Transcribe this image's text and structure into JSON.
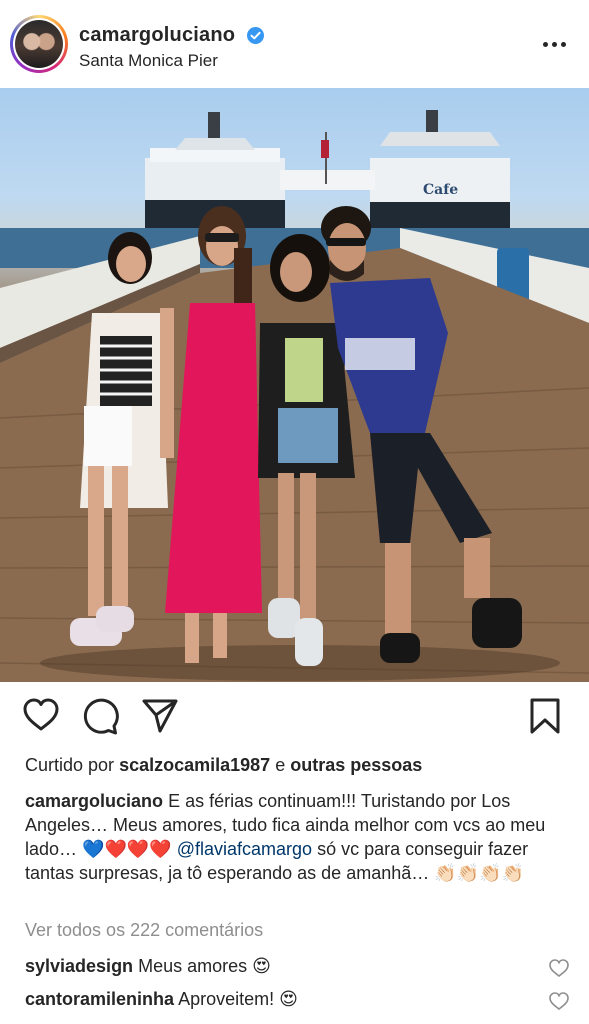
{
  "post": {
    "username": "camargoluciano",
    "location": "Santa Monica Pier",
    "verified": true
  },
  "photo": {
    "signage": "Cafe",
    "description_icon": "family-photo-on-pier"
  },
  "actions": {
    "icons": [
      "heart-icon",
      "comment-icon",
      "share-icon",
      "bookmark-icon"
    ]
  },
  "likes": {
    "prefix": "Curtido por",
    "user": "scalzocamila1987",
    "joiner": "e",
    "others": "outras pessoas"
  },
  "caption": {
    "username": "camargoluciano",
    "text_1": "E as férias continuam!!! Turistando por Los Angeles… Meus amores, tudo fica ainda melhor com vcs ao meu lado…",
    "emojis_1": "💙❤️❤️❤️",
    "mention": "@flaviafcamargo",
    "text_2": "só vc para conseguir fazer tantas surpresas, ja tô esperando as de amanhã…",
    "emojis_2": "👏🏻👏🏻👏🏻👏🏻"
  },
  "view_all_comments": "Ver todos os 222 comentários",
  "comments": [
    {
      "user": "sylviadesign",
      "text": "Meus amores",
      "emoji": "😍"
    },
    {
      "user": "cantoramileninha",
      "text": "Aproveitem!",
      "emoji": "😍"
    }
  ],
  "colors": {
    "text": "#262626",
    "muted": "#8e8e8e",
    "link": "#00376b",
    "verified": "#3897f0",
    "heart_red": "#e0182d",
    "heart_blue": "#1e6fe0"
  }
}
